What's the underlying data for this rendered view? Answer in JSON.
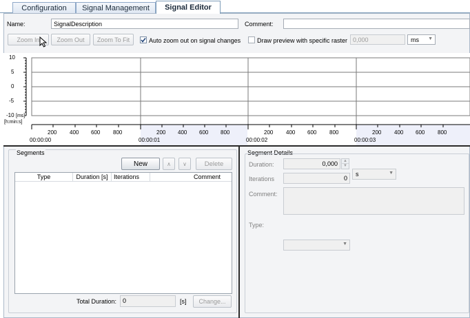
{
  "tabs": [
    {
      "label": "Configuration"
    },
    {
      "label": "Signal Management"
    },
    {
      "label": "Signal Editor"
    }
  ],
  "form": {
    "name_label": "Name:",
    "name_value": "SignalDescription",
    "comment_label": "Comment:",
    "comment_value": ""
  },
  "toolbar": {
    "zoom_in": "Zoom In",
    "zoom_out": "Zoom Out",
    "zoom_to_fit": "Zoom To Fit",
    "auto_zoom_label": "Auto zoom out on signal changes",
    "auto_zoom_checked": true,
    "draw_preview_label": "Draw preview with specific raster",
    "draw_preview_checked": false,
    "raster_value": "0,000",
    "raster_unit": "ms"
  },
  "chart": {
    "y_ticks": [
      "10",
      "5",
      "0",
      "-5",
      "-10"
    ],
    "y_unit": "[ms]",
    "x_unit": "[h:min:s]",
    "x_minor_ticks": [
      "200",
      "400",
      "600",
      "800"
    ],
    "x_major_ticks": [
      "00:00:00",
      "00:00:01",
      "00:00:02",
      "00:00:03"
    ]
  },
  "segments": {
    "title": "Segments",
    "new_button": "New",
    "up_button": "∧",
    "down_button": "∨",
    "delete_button": "Delete",
    "columns": [
      "Type",
      "Duration [s]",
      "Iterations",
      "Comment"
    ],
    "rows": [],
    "total_duration_label": "Total Duration:",
    "total_duration_value": "0",
    "total_duration_unit": "[s]",
    "change_button": "Change..."
  },
  "details": {
    "title": "Segment Details",
    "duration_label": "Duration:",
    "duration_value": "0,000",
    "duration_unit": "s",
    "iterations_label": "Iterations",
    "iterations_value": "0",
    "comment_label": "Comment:",
    "comment_value": "",
    "type_label": "Type:",
    "type_value": ""
  }
}
